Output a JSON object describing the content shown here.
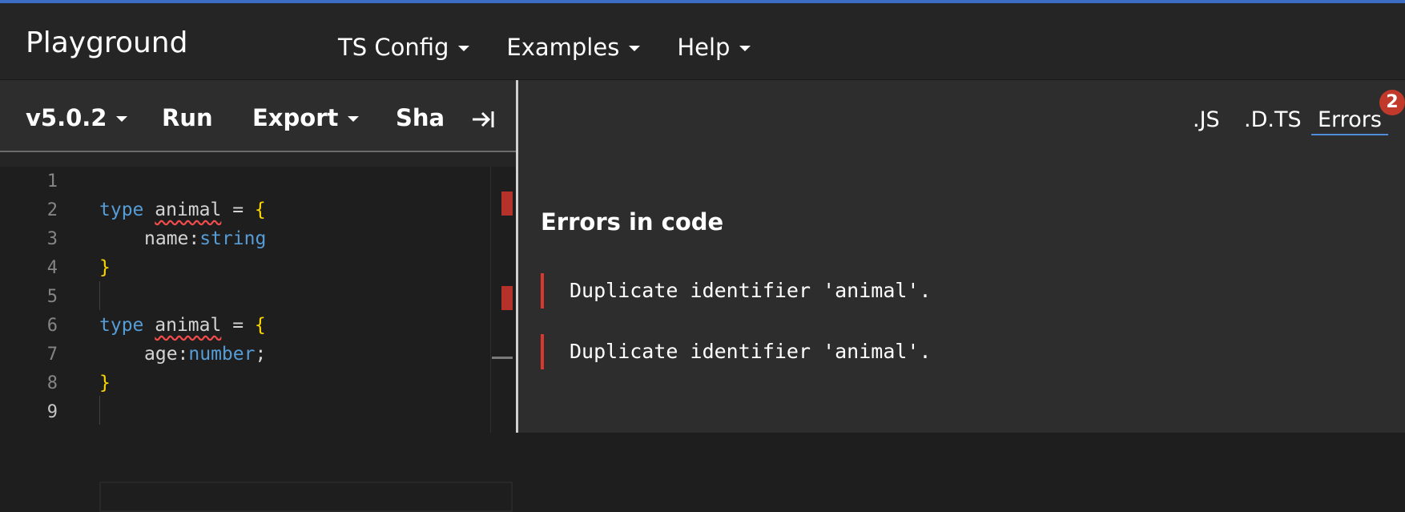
{
  "app": {
    "title": "Playground"
  },
  "nav": {
    "items": [
      {
        "label": "TS Config"
      },
      {
        "label": "Examples"
      },
      {
        "label": "Help"
      }
    ]
  },
  "toolbar": {
    "version_label": "v5.0.2",
    "run_label": "Run",
    "export_label": "Export",
    "share_label": "Share",
    "collapse_icon": "collapse-right-icon"
  },
  "editor": {
    "line_numbers": [
      "1",
      "2",
      "3",
      "4",
      "5",
      "6",
      "7",
      "8",
      "9"
    ],
    "active_line": "9",
    "lines": {
      "l2": {
        "kw": "type",
        "name": "animal",
        "eq": " = ",
        "open": "{"
      },
      "l3": {
        "prop": "name:",
        "type": "string"
      },
      "l4": {
        "close": "}"
      },
      "l6": {
        "kw": "type",
        "name": "animal",
        "eq": " = ",
        "open": "{"
      },
      "l7": {
        "prop": "age:",
        "type": "number",
        "semi": ";"
      },
      "l8": {
        "close": "}"
      }
    }
  },
  "output": {
    "tabs": [
      {
        "label": ".JS"
      },
      {
        "label": ".D.TS"
      },
      {
        "label": "Errors"
      }
    ],
    "active_tab": "Errors",
    "error_count": "2",
    "heading": "Errors in code",
    "errors": [
      "Duplicate identifier 'animal'.",
      "Duplicate identifier 'animal'."
    ]
  },
  "colors": {
    "accent": "#3c6cc4",
    "error": "#d9382c",
    "keyword": "#569cd6",
    "bracket": "#ffd700"
  }
}
